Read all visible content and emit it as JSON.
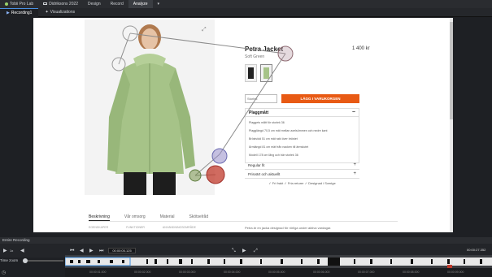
{
  "app": {
    "logo_icon": "tobii-logo-icon",
    "title": "Tobii Pro Lab",
    "tabs": [
      {
        "label": "Didriksons 2022"
      },
      {
        "label": "Design"
      },
      {
        "label": "Record"
      },
      {
        "label": "Analyze",
        "active": true
      }
    ]
  },
  "subbar": {
    "tabs": [
      {
        "label": "Recording1",
        "icon": "play-icon",
        "active": true
      },
      {
        "label": "Visualizations",
        "icon": "visualization-icon"
      }
    ]
  },
  "product": {
    "name": "Petra Jacket",
    "color": "Soft Green",
    "price": "1 400 kr",
    "size_placeholder": "Storlek",
    "add_to_cart": "LÄGG I VARUKORGEN",
    "panel_title": "Plaggmått",
    "panel_lines": [
      "Plaggets mått för storlek 36",
      "Plagglängd 70,5 cm mät mellan axelsömmen och nedre kant",
      "Bröstvidd 51 cm mät rakt över bröstet",
      "Ärmlängd 81 cm mät från nacken till ärmslutet",
      "Modell 178 cm lång och bär storlek 36"
    ],
    "accordions": [
      "Regular fit",
      "Prisvärt och aktuellt"
    ],
    "usps": "✓ Fri frakt   ✓ Fria returer   ✓ Designad i Sverige",
    "tabs": [
      "Beskrivning",
      "Vår omsorg",
      "Material",
      "Skötselråd"
    ],
    "tab_columns": [
      "EGENSKAPER",
      "FUNKTIONER",
      "ANVÄNDNINGSOMRÅDE"
    ],
    "description": "Petra är en jacka designad för rörliga under aktiva vardagar."
  },
  "timeline": {
    "header": "Entire Recording",
    "time_current": "00:00:05.125",
    "time_total": "00:00:27.352",
    "time_zoom_label": "Time zoom",
    "ruler_ticks": [
      "00:00:01.000",
      "00:00:02.000",
      "00:00:03.000",
      "00:00:04.000",
      "00:00:05.000",
      "00:00:06.000",
      "00:00:07.000",
      "00:00:08.000",
      "00:00:09.000"
    ]
  },
  "colors": {
    "accent_orange": "#e85a14",
    "gaze_red": "#c0392b",
    "gaze_blue": "#4a70c8"
  }
}
